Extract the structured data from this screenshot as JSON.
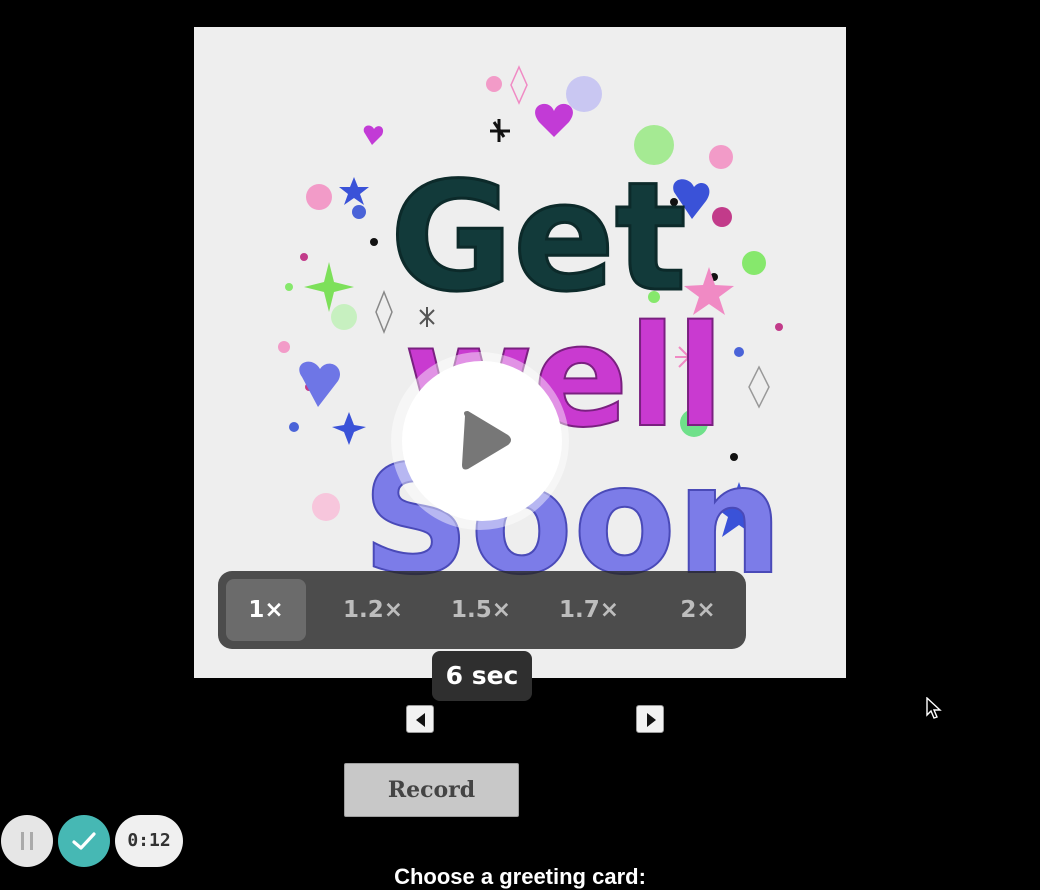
{
  "card": {
    "line1": "Get",
    "line2": "well",
    "line3": "Soon"
  },
  "player": {
    "play_icon": "play-icon",
    "speed_options": [
      "1×",
      "1.2×",
      "1.5×",
      "1.7×",
      "2×"
    ],
    "selected_speed": "1×",
    "duration_label": "6 sec"
  },
  "navigation": {
    "prev_icon": "triangle-left-icon",
    "next_icon": "triangle-right-icon"
  },
  "record": {
    "label": "Record"
  },
  "choose": {
    "label": "Choose a greeting card:"
  },
  "recorder": {
    "pause_icon": "pause-icon",
    "done_icon": "checkmark-icon",
    "timer": "0:12",
    "accent_color": "#46b8b4"
  }
}
